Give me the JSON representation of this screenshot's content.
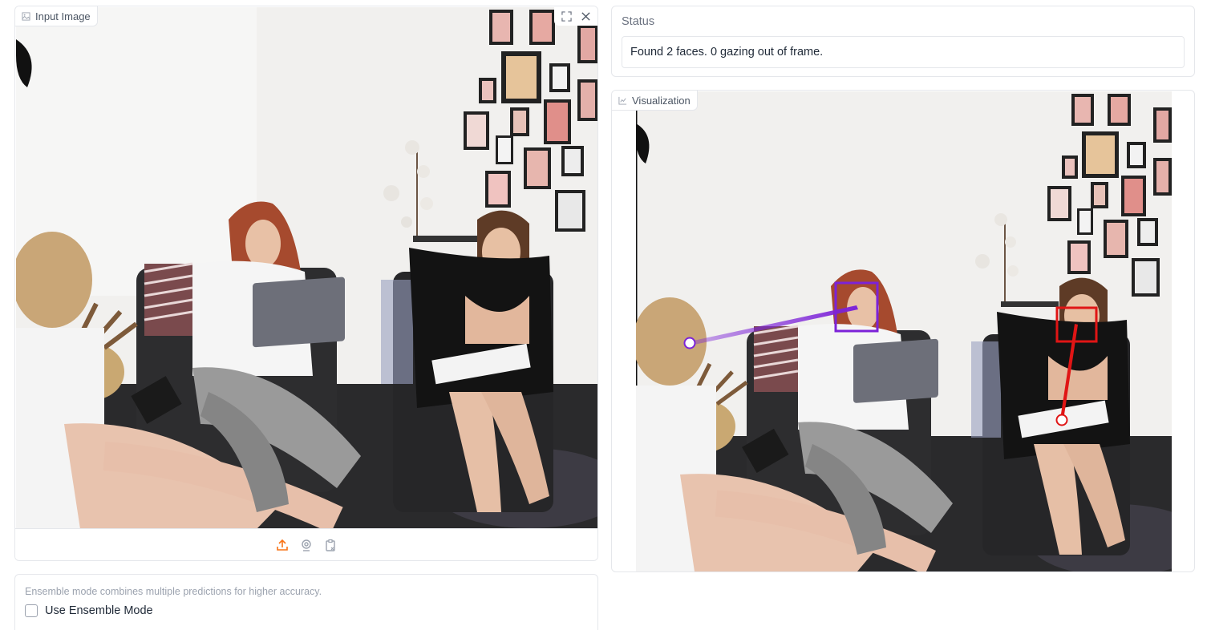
{
  "input_panel": {
    "label": "Input Image",
    "label_icon": "image-icon",
    "fullscreen_icon": "fullscreen-icon",
    "clear_icon": "close-icon",
    "sources": [
      {
        "name": "upload-source",
        "icon": "upload-icon",
        "active": true
      },
      {
        "name": "webcam-source",
        "icon": "webcam-icon",
        "active": false
      },
      {
        "name": "clipboard-source",
        "icon": "clipboard-icon",
        "active": false
      }
    ]
  },
  "ensemble": {
    "info": "Ensemble mode combines multiple predictions for higher accuracy.",
    "checkbox_label": "Use Ensemble Mode",
    "checked": false
  },
  "status": {
    "title": "Status",
    "value": "Found 2 faces. 0 gazing out of frame."
  },
  "visualization": {
    "label": "Visualization",
    "label_icon": "chart-icon",
    "detections": [
      {
        "color": "#7c22d8",
        "box_color": "purple"
      },
      {
        "color": "#e01515",
        "box_color": "red"
      }
    ]
  },
  "colors": {
    "accent": "#f97316",
    "border": "#e5e7eb"
  }
}
